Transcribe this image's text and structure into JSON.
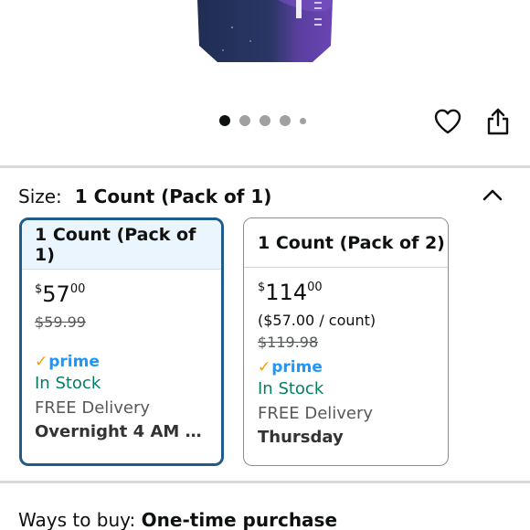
{
  "gallery": {
    "dots": [
      {
        "state": "active"
      },
      {
        "state": "inactive"
      },
      {
        "state": "inactive"
      },
      {
        "state": "inactive"
      },
      {
        "state": "small"
      }
    ]
  },
  "actions": {
    "favorite_icon": "heart-icon",
    "share_icon": "share-icon"
  },
  "size_selector": {
    "label": "Size:",
    "selected_value": "1 Count (Pack of 1)",
    "toggle_icon": "chevron-up-icon"
  },
  "options": [
    {
      "title": "1 Count (Pack of 1)",
      "price_symbol": "$",
      "price_whole": "57",
      "price_fraction": "00",
      "unit_price": "",
      "list_price": "$59.99",
      "prime_check": "✓",
      "prime_label": "prime",
      "stock": "In Stock",
      "delivery": "FREE Delivery",
      "delivery_time": "Overnight 4 AM - 8…"
    },
    {
      "title": "1 Count (Pack of 2)",
      "price_symbol": "$",
      "price_whole": "114",
      "price_fraction": "00",
      "unit_price": "($57.00 / count)",
      "list_price": "$119.98",
      "prime_check": "✓",
      "prime_label": "prime",
      "stock": "In Stock",
      "delivery": "FREE Delivery",
      "delivery_time": "Thursday"
    }
  ],
  "ways_to_buy": {
    "label": "Ways to buy:",
    "value": "One-time purchase"
  },
  "colors": {
    "selected_border": "#1f5c8a",
    "selected_header_bg": "#eaf5fd",
    "prime_blue": "#1a98ff",
    "prime_check": "#ff9900",
    "in_stock_green": "#067d62"
  }
}
